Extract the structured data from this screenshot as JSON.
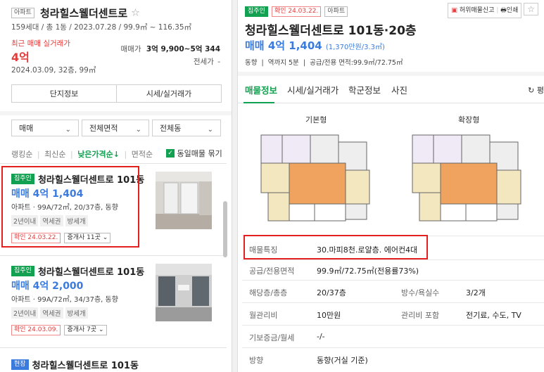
{
  "complex": {
    "type_badge": "아파트",
    "name": "청라힐스웰더센트로",
    "star_icon": "star-outline-icon",
    "sub": "159세대 / 총 1동 / 2023.07.28 / 99.9㎡ ~ 116.35㎡",
    "recent_label": "최근 매매 실거래가",
    "recent_price": "4억",
    "recent_date": "2024.03.09, 32층, 99㎡",
    "trade_range_label": "매매가",
    "trade_range_value": "3억 9,900~5억 344",
    "rent_label": "전세가",
    "rent_value": "-",
    "btn_info": "단지정보",
    "btn_price": "시세/실거래가"
  },
  "filters": {
    "trade": "매매",
    "area": "전체면적",
    "dong": "전체동"
  },
  "sort": {
    "items": [
      "랭킹순",
      "최신순",
      "낮은가격순↓",
      "면적순"
    ],
    "active_index": 2,
    "same_listing_label": "동일매물 묶기"
  },
  "listings": [
    {
      "badge": "집주인",
      "title": "청라힐스웰더센트로 101동",
      "price": "매매 4억 1,404",
      "info": "아파트 · 99A/72㎡, 20/37층, 동향",
      "tags": [
        "2년이내",
        "역세권",
        "방세개"
      ],
      "confirm": "확인 24.03.22.",
      "agent": "중개사 11곳"
    },
    {
      "badge": "집주인",
      "title": "청라힐스웰더센트로 101동",
      "price": "매매 4억 2,000",
      "info": "아파트 · 99A/72㎡, 34/37층, 동향",
      "tags": [
        "2년이내",
        "역세권",
        "방세개"
      ],
      "confirm": "확인 24.03.09.",
      "agent": "중개사 7곳"
    },
    {
      "badge": "현장",
      "title": "청라힐스웰더센트로 101동"
    }
  ],
  "detail": {
    "badge_owner": "집주인",
    "badge_confirm": "확인 24.03.22.",
    "badge_type": "아파트",
    "report_label": "허위매물신고",
    "print_label": "인쇄",
    "title": "청라힐스웰더센트로 101동·20층",
    "price": "매매 4억 1,404",
    "price_unit": "(1,370만원/3.3㎡)",
    "meta": "동향  |  역까지 5분  |  공급/전용 면적:99.9㎡/72.75㎡",
    "tabs": [
      "매물정보",
      "시세/실거래가",
      "학군정보",
      "사진"
    ],
    "active_tab": 0,
    "fold_label": "평",
    "plan_basic": "기본형",
    "plan_extended": "확장형",
    "rows": [
      {
        "label": "매물특징",
        "value": "30.마피8천.로얄층. 에어컨4대"
      },
      {
        "label": "공급/전용면적",
        "value": "99.9㎡/72.75㎡(전용률73%)"
      },
      {
        "label": "해당층/총층",
        "value": "20/37층",
        "label2": "방수/욕실수",
        "value2": "3/2개"
      },
      {
        "label": "월관리비",
        "value": "10만원",
        "label2": "관리비 포함",
        "value2": "전기료, 수도, TV"
      },
      {
        "label": "기보증금/월세",
        "value": "-/-"
      },
      {
        "label": "방향",
        "value": "동향(거실 기준)"
      }
    ]
  },
  "colors": {
    "accent_blue": "#3b7bdd",
    "green": "#12a150",
    "red_box": "#e31f1f"
  }
}
